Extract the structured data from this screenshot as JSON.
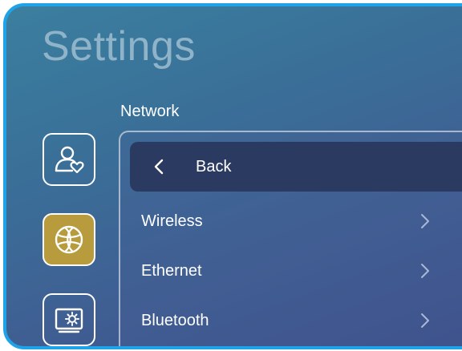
{
  "page": {
    "title": "Settings"
  },
  "section": {
    "title": "Network"
  },
  "sidebar": {
    "items": [
      {
        "icon": "user-heart-icon",
        "active": false
      },
      {
        "icon": "globe-icon",
        "active": true
      },
      {
        "icon": "display-settings-icon",
        "active": false
      }
    ],
    "active_color": "#b79b3c"
  },
  "panel": {
    "back_label": "Back",
    "items": [
      {
        "label": "Wireless"
      },
      {
        "label": "Ethernet"
      },
      {
        "label": "Bluetooth"
      }
    ]
  },
  "colors": {
    "frame_border": "#1fa3e8",
    "back_row_bg": "#2b3a60"
  }
}
